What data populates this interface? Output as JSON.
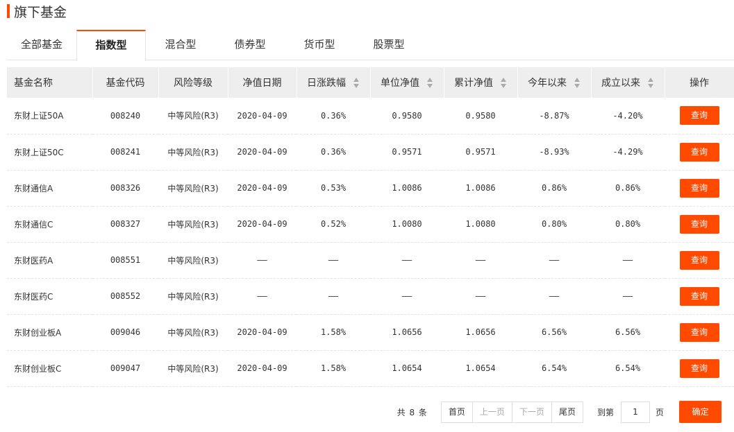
{
  "section": {
    "title": "旗下基金"
  },
  "tabs": [
    {
      "label": "全部基金"
    },
    {
      "label": "指数型"
    },
    {
      "label": "混合型"
    },
    {
      "label": "债券型"
    },
    {
      "label": "货币型"
    },
    {
      "label": "股票型"
    }
  ],
  "active_tab": "指数型",
  "table": {
    "headers": [
      "基金名称",
      "基金代码",
      "风险等级",
      "净值日期",
      "日涨跌幅",
      "单位净值",
      "累计净值",
      "今年以来",
      "成立以来",
      "操作"
    ],
    "rows": [
      {
        "name": "东财上证50A",
        "code": "008240",
        "risk": "中等风险(R3)",
        "date": "2020-04-09",
        "daily": "0.36%",
        "nav": "0.9580",
        "acc_nav": "0.9580",
        "ytd": "-8.87%",
        "since": "-4.20%",
        "action": "查询"
      },
      {
        "name": "东财上证50C",
        "code": "008241",
        "risk": "中等风险(R3)",
        "date": "2020-04-09",
        "daily": "0.36%",
        "nav": "0.9571",
        "acc_nav": "0.9571",
        "ytd": "-8.93%",
        "since": "-4.29%",
        "action": "查询"
      },
      {
        "name": "东财通信A",
        "code": "008326",
        "risk": "中等风险(R3)",
        "date": "2020-04-09",
        "daily": "0.53%",
        "nav": "1.0086",
        "acc_nav": "1.0086",
        "ytd": "0.86%",
        "since": "0.86%",
        "action": "查询"
      },
      {
        "name": "东财通信C",
        "code": "008327",
        "risk": "中等风险(R3)",
        "date": "2020-04-09",
        "daily": "0.52%",
        "nav": "1.0080",
        "acc_nav": "1.0080",
        "ytd": "0.80%",
        "since": "0.80%",
        "action": "查询"
      },
      {
        "name": "东财医药A",
        "code": "008551",
        "risk": "中等风险(R3)",
        "date": "——",
        "daily": "——",
        "nav": "——",
        "acc_nav": "——",
        "ytd": "——",
        "since": "——",
        "action": "查询"
      },
      {
        "name": "东财医药C",
        "code": "008552",
        "risk": "中等风险(R3)",
        "date": "——",
        "daily": "——",
        "nav": "——",
        "acc_nav": "——",
        "ytd": "——",
        "since": "——",
        "action": "查询"
      },
      {
        "name": "东财创业板A",
        "code": "009046",
        "risk": "中等风险(R3)",
        "date": "2020-04-09",
        "daily": "1.58%",
        "nav": "1.0656",
        "acc_nav": "1.0656",
        "ytd": "6.56%",
        "since": "6.56%",
        "action": "查询"
      },
      {
        "name": "东财创业板C",
        "code": "009047",
        "risk": "中等风险(R3)",
        "date": "2020-04-09",
        "daily": "1.58%",
        "nav": "1.0654",
        "acc_nav": "1.0654",
        "ytd": "6.54%",
        "since": "6.54%",
        "action": "查询"
      }
    ]
  },
  "pagination": {
    "total_text": "共 8 条",
    "first": "首页",
    "prev": "上一页",
    "next": "下一页",
    "last": "尾页",
    "goto_label": "到第",
    "page_value": "1",
    "page_unit": "页",
    "confirm": "确定"
  },
  "colors": {
    "accent": "#ff4a00",
    "up": "#e02020",
    "down": "#1a9a2c",
    "header_bg": "#eeeeee"
  }
}
